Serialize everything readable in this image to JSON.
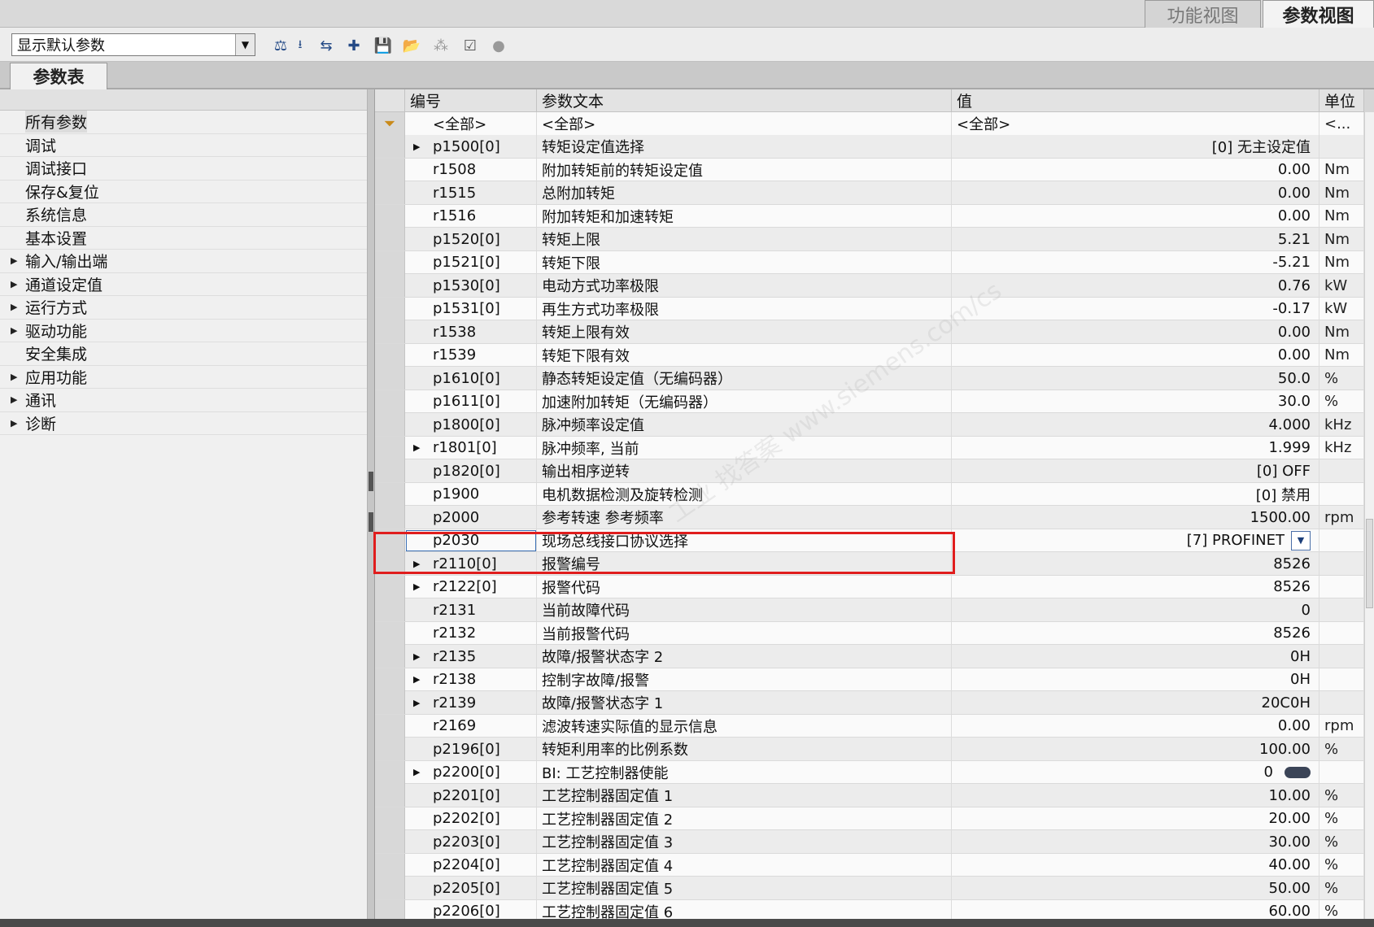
{
  "view_tabs": {
    "function_view": "功能视图",
    "parameter_view": "参数视图"
  },
  "toolbar": {
    "view_select": "显示默认参数"
  },
  "section_tab": "参数表",
  "tree": {
    "items": [
      {
        "label": "所有参数",
        "expandable": false,
        "selected": true
      },
      {
        "label": "调试",
        "expandable": false
      },
      {
        "label": "调试接口",
        "expandable": false
      },
      {
        "label": "保存&复位",
        "expandable": false
      },
      {
        "label": "系统信息",
        "expandable": false
      },
      {
        "label": "基本设置",
        "expandable": false
      },
      {
        "label": "输入/输出端",
        "expandable": true
      },
      {
        "label": "通道设定值",
        "expandable": true
      },
      {
        "label": "运行方式",
        "expandable": true
      },
      {
        "label": "驱动功能",
        "expandable": true
      },
      {
        "label": "安全集成",
        "expandable": false
      },
      {
        "label": "应用功能",
        "expandable": true
      },
      {
        "label": "通讯",
        "expandable": true
      },
      {
        "label": "诊断",
        "expandable": true
      }
    ]
  },
  "table": {
    "headers": {
      "number": "编号",
      "text": "参数文本",
      "value": "值",
      "unit": "单位"
    },
    "filter": {
      "number": "<全部>",
      "text": "<全部>",
      "value": "<全部>",
      "unit": "<..."
    },
    "rows": [
      {
        "num": "p1500[0]",
        "text": "转矩设定值选择",
        "value": "[0] 无主设定值",
        "unit": "",
        "exp": true
      },
      {
        "num": "r1508",
        "text": "附加转矩前的转矩设定值",
        "value": "0.00",
        "unit": "Nm"
      },
      {
        "num": "r1515",
        "text": "总附加转矩",
        "value": "0.00",
        "unit": "Nm"
      },
      {
        "num": "r1516",
        "text": "附加转矩和加速转矩",
        "value": "0.00",
        "unit": "Nm"
      },
      {
        "num": "p1520[0]",
        "text": "转矩上限",
        "value": "5.21",
        "unit": "Nm"
      },
      {
        "num": "p1521[0]",
        "text": "转矩下限",
        "value": "-5.21",
        "unit": "Nm"
      },
      {
        "num": "p1530[0]",
        "text": "电动方式功率极限",
        "value": "0.76",
        "unit": "kW"
      },
      {
        "num": "p1531[0]",
        "text": "再生方式功率极限",
        "value": "-0.17",
        "unit": "kW"
      },
      {
        "num": "r1538",
        "text": "转矩上限有效",
        "value": "0.00",
        "unit": "Nm"
      },
      {
        "num": "r1539",
        "text": "转矩下限有效",
        "value": "0.00",
        "unit": "Nm"
      },
      {
        "num": "p1610[0]",
        "text": "静态转矩设定值（无编码器）",
        "value": "50.0",
        "unit": "%"
      },
      {
        "num": "p1611[0]",
        "text": "加速附加转矩（无编码器）",
        "value": "30.0",
        "unit": "%"
      },
      {
        "num": "p1800[0]",
        "text": "脉冲频率设定值",
        "value": "4.000",
        "unit": "kHz"
      },
      {
        "num": "r1801[0]",
        "text": "脉冲频率, 当前",
        "value": "1.999",
        "unit": "kHz",
        "exp": true
      },
      {
        "num": "p1820[0]",
        "text": "输出相序逆转",
        "value": "[0] OFF",
        "unit": ""
      },
      {
        "num": "p1900",
        "text": "电机数据检测及旋转检测",
        "value": "[0] 禁用",
        "unit": ""
      },
      {
        "num": "p2000",
        "text": "参考转速 参考频率",
        "value": "1500.00",
        "unit": "rpm"
      },
      {
        "num": "p2030",
        "text": "现场总线接口协议选择",
        "value": "[7] PROFINET",
        "unit": "",
        "dropdown": true,
        "focused": true
      },
      {
        "num": "r2110[0]",
        "text": "报警编号",
        "value": "8526",
        "unit": "",
        "exp": true
      },
      {
        "num": "r2122[0]",
        "text": "报警代码",
        "value": "8526",
        "unit": "",
        "exp": true
      },
      {
        "num": "r2131",
        "text": "当前故障代码",
        "value": "0",
        "unit": ""
      },
      {
        "num": "r2132",
        "text": "当前报警代码",
        "value": "8526",
        "unit": ""
      },
      {
        "num": "r2135",
        "text": "故障/报警状态字 2",
        "value": "0H",
        "unit": "",
        "exp": true
      },
      {
        "num": "r2138",
        "text": "控制字故障/报警",
        "value": "0H",
        "unit": "",
        "exp": true
      },
      {
        "num": "r2139",
        "text": "故障/报警状态字 1",
        "value": "20C0H",
        "unit": "",
        "exp": true
      },
      {
        "num": "r2169",
        "text": "滤波转速实际值的显示信息",
        "value": "0.00",
        "unit": "rpm"
      },
      {
        "num": "p2196[0]",
        "text": "转矩利用率的比例系数",
        "value": "100.00",
        "unit": "%"
      },
      {
        "num": "p2200[0]",
        "text": "BI: 工艺控制器使能",
        "value": "0",
        "unit": "",
        "exp": true,
        "toggle": true
      },
      {
        "num": "p2201[0]",
        "text": "工艺控制器固定值 1",
        "value": "10.00",
        "unit": "%"
      },
      {
        "num": "p2202[0]",
        "text": "工艺控制器固定值 2",
        "value": "20.00",
        "unit": "%"
      },
      {
        "num": "p2203[0]",
        "text": "工艺控制器固定值 3",
        "value": "30.00",
        "unit": "%"
      },
      {
        "num": "p2204[0]",
        "text": "工艺控制器固定值 4",
        "value": "40.00",
        "unit": "%"
      },
      {
        "num": "p2205[0]",
        "text": "工艺控制器固定值 5",
        "value": "50.00",
        "unit": "%"
      },
      {
        "num": "p2206[0]",
        "text": "工艺控制器固定值 6",
        "value": "60.00",
        "unit": "%"
      }
    ]
  },
  "icons": [
    "balance-icon",
    "download-icon",
    "compare-icon",
    "new-icon",
    "save-icon",
    "export-icon",
    "sparkle-icon",
    "checkbox-icon",
    "circle-icon",
    "filter-icon"
  ],
  "watermark": "工业 找答案 www.siemens.com/cs"
}
